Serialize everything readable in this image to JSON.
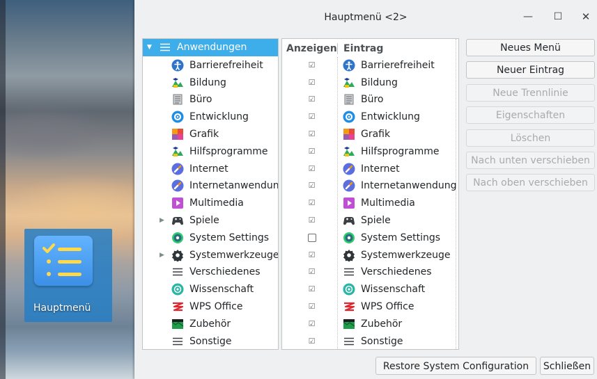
{
  "window": {
    "title": "Hauptmenü <2>",
    "minimize_glyph": "—",
    "maximize_glyph": "☐",
    "close_glyph": "✕"
  },
  "desktop": {
    "icon_label": "Hauptmenü"
  },
  "tree": {
    "root": {
      "label": "Anwendungen",
      "icon": "menu-lines-icon"
    },
    "items": [
      {
        "label": "Barrierefreiheit",
        "icon": "accessibility-icon",
        "color": "#2e74c8",
        "expandable": false
      },
      {
        "label": "Bildung",
        "icon": "education-icon",
        "color": "#2eaa5b",
        "expandable": false
      },
      {
        "label": "Büro",
        "icon": "office-icon",
        "color": "#7b7e82",
        "expandable": false
      },
      {
        "label": "Entwicklung",
        "icon": "development-icon",
        "color": "#1d8de6",
        "expandable": false
      },
      {
        "label": "Grafik",
        "icon": "graphics-icon",
        "color": "#f39c12",
        "expandable": false
      },
      {
        "label": "Hilfsprogramme",
        "icon": "utilities-icon",
        "color": "#2eaa5b",
        "expandable": false
      },
      {
        "label": "Internet",
        "icon": "internet-icon",
        "color": "#5b6ee1",
        "expandable": false
      },
      {
        "label": "Internetanwendun",
        "icon": "web-apps-icon",
        "color": "#5b6ee1",
        "expandable": false
      },
      {
        "label": "Multimedia",
        "icon": "multimedia-icon",
        "color": "#c14fd6",
        "expandable": false
      },
      {
        "label": "Spiele",
        "icon": "games-icon",
        "color": "#3b3e42",
        "expandable": true
      },
      {
        "label": "System Settings",
        "icon": "system-settings-icon",
        "color": "#2a6f7a",
        "expandable": false
      },
      {
        "label": "Systemwerkzeuge",
        "icon": "system-tools-icon",
        "color": "#2f3438",
        "expandable": true
      },
      {
        "label": "Verschiedenes",
        "icon": "miscellaneous-icon",
        "color": "#3b3e42",
        "expandable": false
      },
      {
        "label": "Wissenschaft",
        "icon": "science-icon",
        "color": "#2bb5a6",
        "expandable": false
      },
      {
        "label": "WPS Office",
        "icon": "wps-office-icon",
        "color": "#e0262e",
        "expandable": false
      },
      {
        "label": "Zubehör",
        "icon": "accessories-icon",
        "color": "#1e9e4a",
        "expandable": false
      },
      {
        "label": "Sonstige",
        "icon": "other-icon",
        "color": "#3b3e42",
        "expandable": false
      }
    ]
  },
  "list": {
    "headers": {
      "show": "Anzeigen",
      "entry": "Eintrag"
    },
    "items": [
      {
        "label": "Barrierefreiheit",
        "checked": true
      },
      {
        "label": "Bildung",
        "checked": true
      },
      {
        "label": "Büro",
        "checked": true
      },
      {
        "label": "Entwicklung",
        "checked": true
      },
      {
        "label": "Grafik",
        "checked": true
      },
      {
        "label": "Hilfsprogramme",
        "checked": true
      },
      {
        "label": "Internet",
        "checked": true
      },
      {
        "label": "Internetanwendung",
        "checked": true
      },
      {
        "label": "Multimedia",
        "checked": true
      },
      {
        "label": "Spiele",
        "checked": true
      },
      {
        "label": "System Settings",
        "checked": false
      },
      {
        "label": "Systemwerkzeuge",
        "checked": true
      },
      {
        "label": "Verschiedenes",
        "checked": true
      },
      {
        "label": "Wissenschaft",
        "checked": true
      },
      {
        "label": "WPS Office",
        "checked": true
      },
      {
        "label": "Zubehör",
        "checked": true
      },
      {
        "label": "Sonstige",
        "checked": true
      }
    ]
  },
  "buttons": [
    {
      "label": "Neues Menü",
      "enabled": true,
      "name": "new-menu-button"
    },
    {
      "label": "Neuer Eintrag",
      "enabled": true,
      "name": "new-entry-button"
    },
    {
      "label": "Neue Trennlinie",
      "enabled": false,
      "name": "new-separator-button"
    },
    {
      "label": "Eigenschaften",
      "enabled": false,
      "name": "properties-button"
    },
    {
      "label": "Löschen",
      "enabled": false,
      "name": "delete-button"
    },
    {
      "label": "Nach unten verschieben",
      "enabled": false,
      "name": "move-down-button"
    },
    {
      "label": "Nach oben verschieben",
      "enabled": false,
      "name": "move-up-button"
    }
  ],
  "footer": {
    "restore_label": "Restore System Configuration",
    "close_label": "Schließen"
  },
  "colors": {
    "selection": "#3daee9",
    "accent": "#3daee9"
  }
}
